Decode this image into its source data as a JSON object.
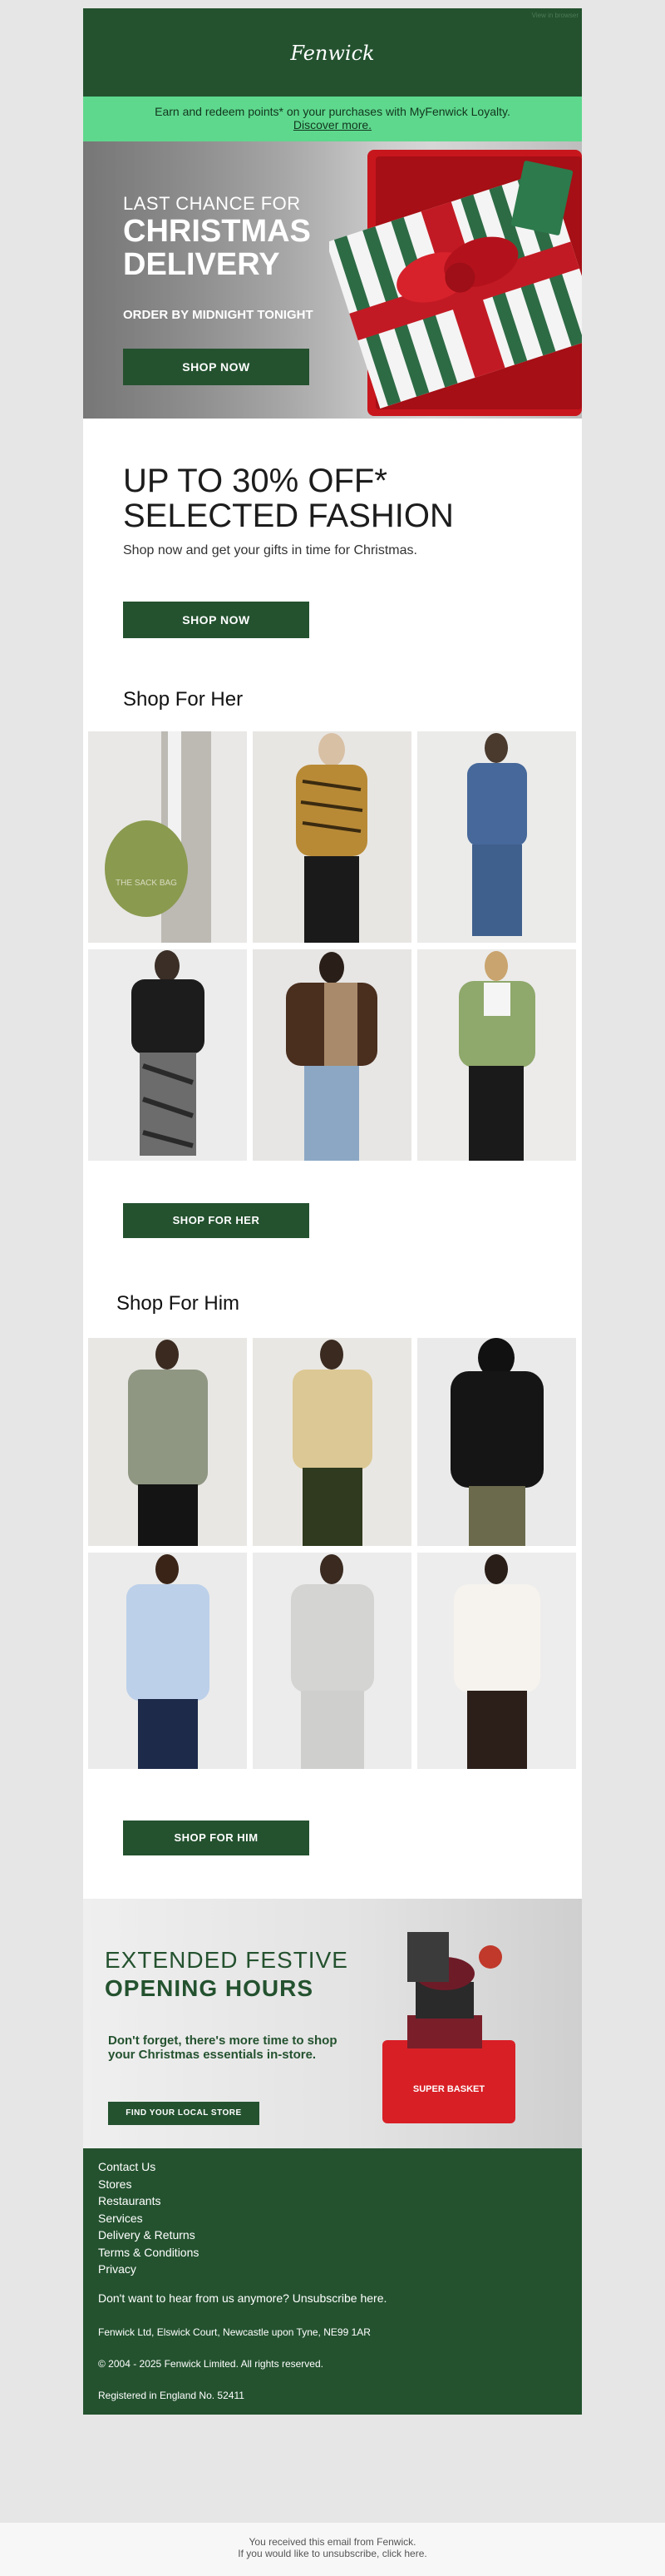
{
  "header": {
    "view_online": "View in browser",
    "logo": "Fenwick"
  },
  "loyalty": {
    "text": "Earn and redeem points* on your purchases with MyFenwick Loyalty.",
    "link": "Discover more."
  },
  "hero": {
    "small": "LAST CHANCE FOR",
    "big": "CHRISTMAS DELIVERY",
    "sub": "ORDER BY MIDNIGHT TONIGHT",
    "button": "SHOP NOW"
  },
  "offer": {
    "title": "UP TO 30% OFF* SELECTED FASHION",
    "subtitle": "Shop now and get your gifts in time for Christmas.",
    "button": "SHOP NOW"
  },
  "her": {
    "heading": "Shop For Her",
    "button": "SHOP FOR HER",
    "bag_text": "THE SACK BAG"
  },
  "him": {
    "heading": "Shop For Him",
    "button": "SHOP FOR HIM"
  },
  "opening": {
    "small": "EXTENDED FESTIVE",
    "big": "OPENING HOURS",
    "body": "Don't forget, there's more time to shop your Christmas essentials in-store.",
    "button": "FIND YOUR LOCAL STORE",
    "basket_label": "SUPER BASKET"
  },
  "footer": {
    "links": [
      "Contact Us",
      "Stores",
      "Restaurants",
      "Services",
      "Delivery & Returns",
      "Terms & Conditions",
      "Privacy"
    ],
    "unsubscribe": "Don't want to hear from us anymore? Unsubscribe here.",
    "address": "Fenwick Ltd, Elswick Court, Newcastle upon Tyne, NE99 1AR",
    "copyright": "© 2004 - 2025 Fenwick Limited. All rights reserved.",
    "registered": "Registered in England No. 52411"
  },
  "bottom": {
    "line1": "You received this email from Fenwick.",
    "line2": "If you would like to unsubscribe, click here."
  },
  "colors": {
    "brand_green": "#24522f",
    "loyalty_green": "#5ed88d"
  }
}
